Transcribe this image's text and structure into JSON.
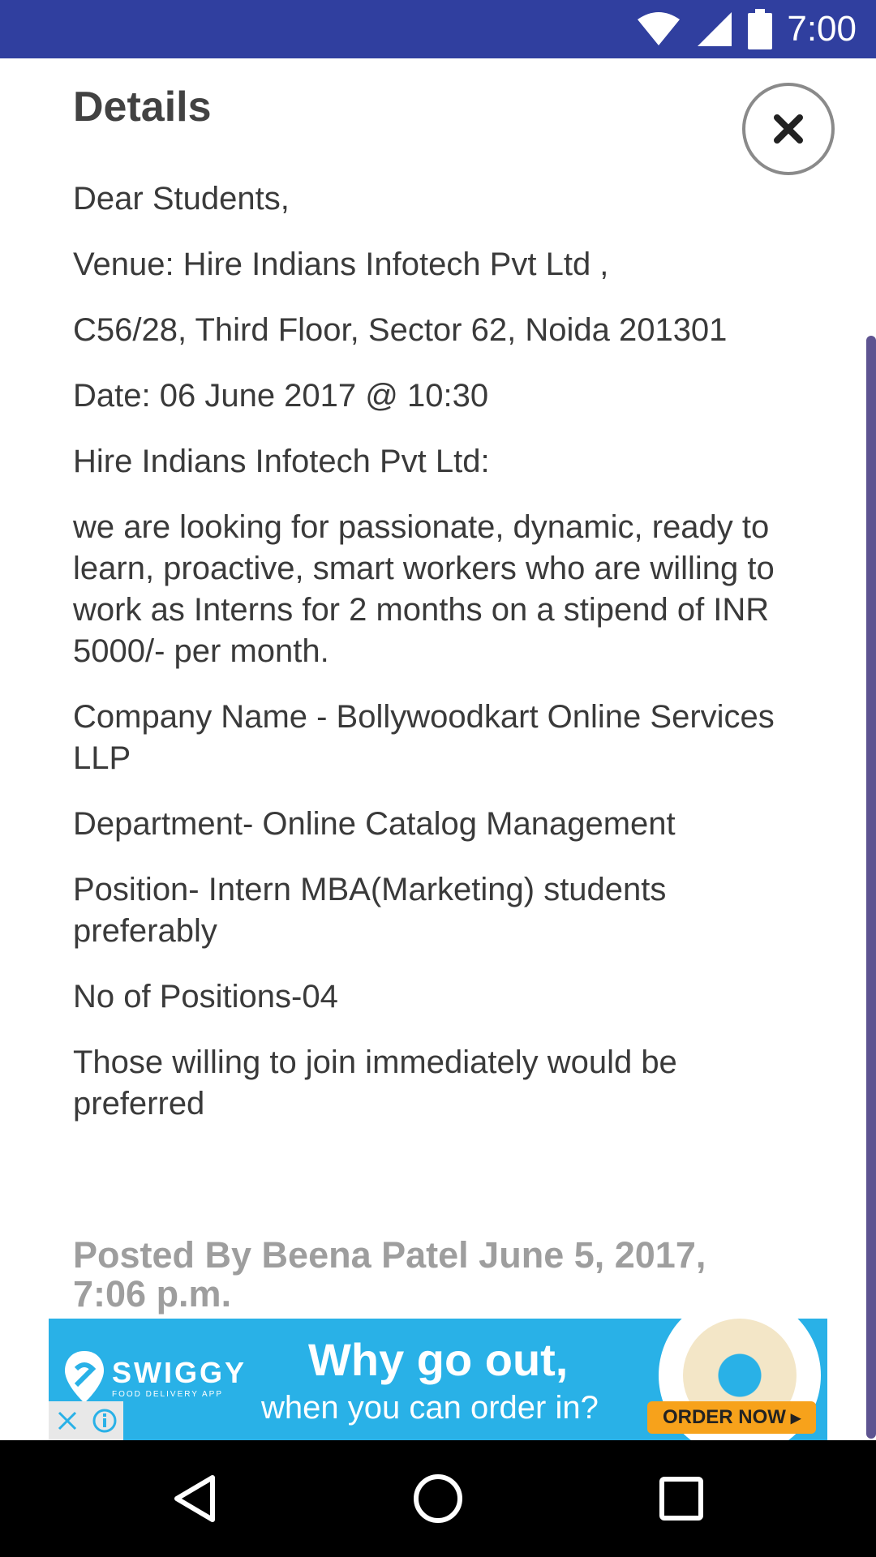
{
  "status_bar": {
    "time": "7:00",
    "icons": [
      "wifi-icon",
      "signal-icon",
      "battery-icon"
    ],
    "color": "#303F9F"
  },
  "dialog": {
    "title": "Details",
    "close_icon": "close-icon",
    "paragraphs": [
      "Dear Students,",
      "Venue: Hire Indians Infotech Pvt Ltd ,",
      "C56/28, Third Floor, Sector 62, Noida 201301",
      "Date: 06 June 2017 @ 10:30",
      "Hire Indians Infotech Pvt Ltd:",
      "we are looking for passionate, dynamic, ready to learn, proactive, smart workers who are willing to work as Interns for 2 months on a stipend of INR 5000/- per month.",
      "Company Name - Bollywoodkart Online Services LLP",
      "Department- Online Catalog Management",
      "Position- Intern MBA(Marketing)  students preferably",
      "No of Positions-04",
      "Those willing to join immediately would be preferred"
    ],
    "posted_by": "Posted By Beena Patel June 5, 2017, 7:06 p.m."
  },
  "ad": {
    "brand": "SWIGGY",
    "brand_tagline": "FOOD DELIVERY APP",
    "headline": "Why go out,",
    "subline": "when you can order in?",
    "cta": "ORDER NOW",
    "background": "#29B1E7",
    "cta_color": "#F7A21B"
  },
  "nav_bar": {
    "buttons": [
      "back-icon",
      "home-icon",
      "recents-icon"
    ]
  }
}
